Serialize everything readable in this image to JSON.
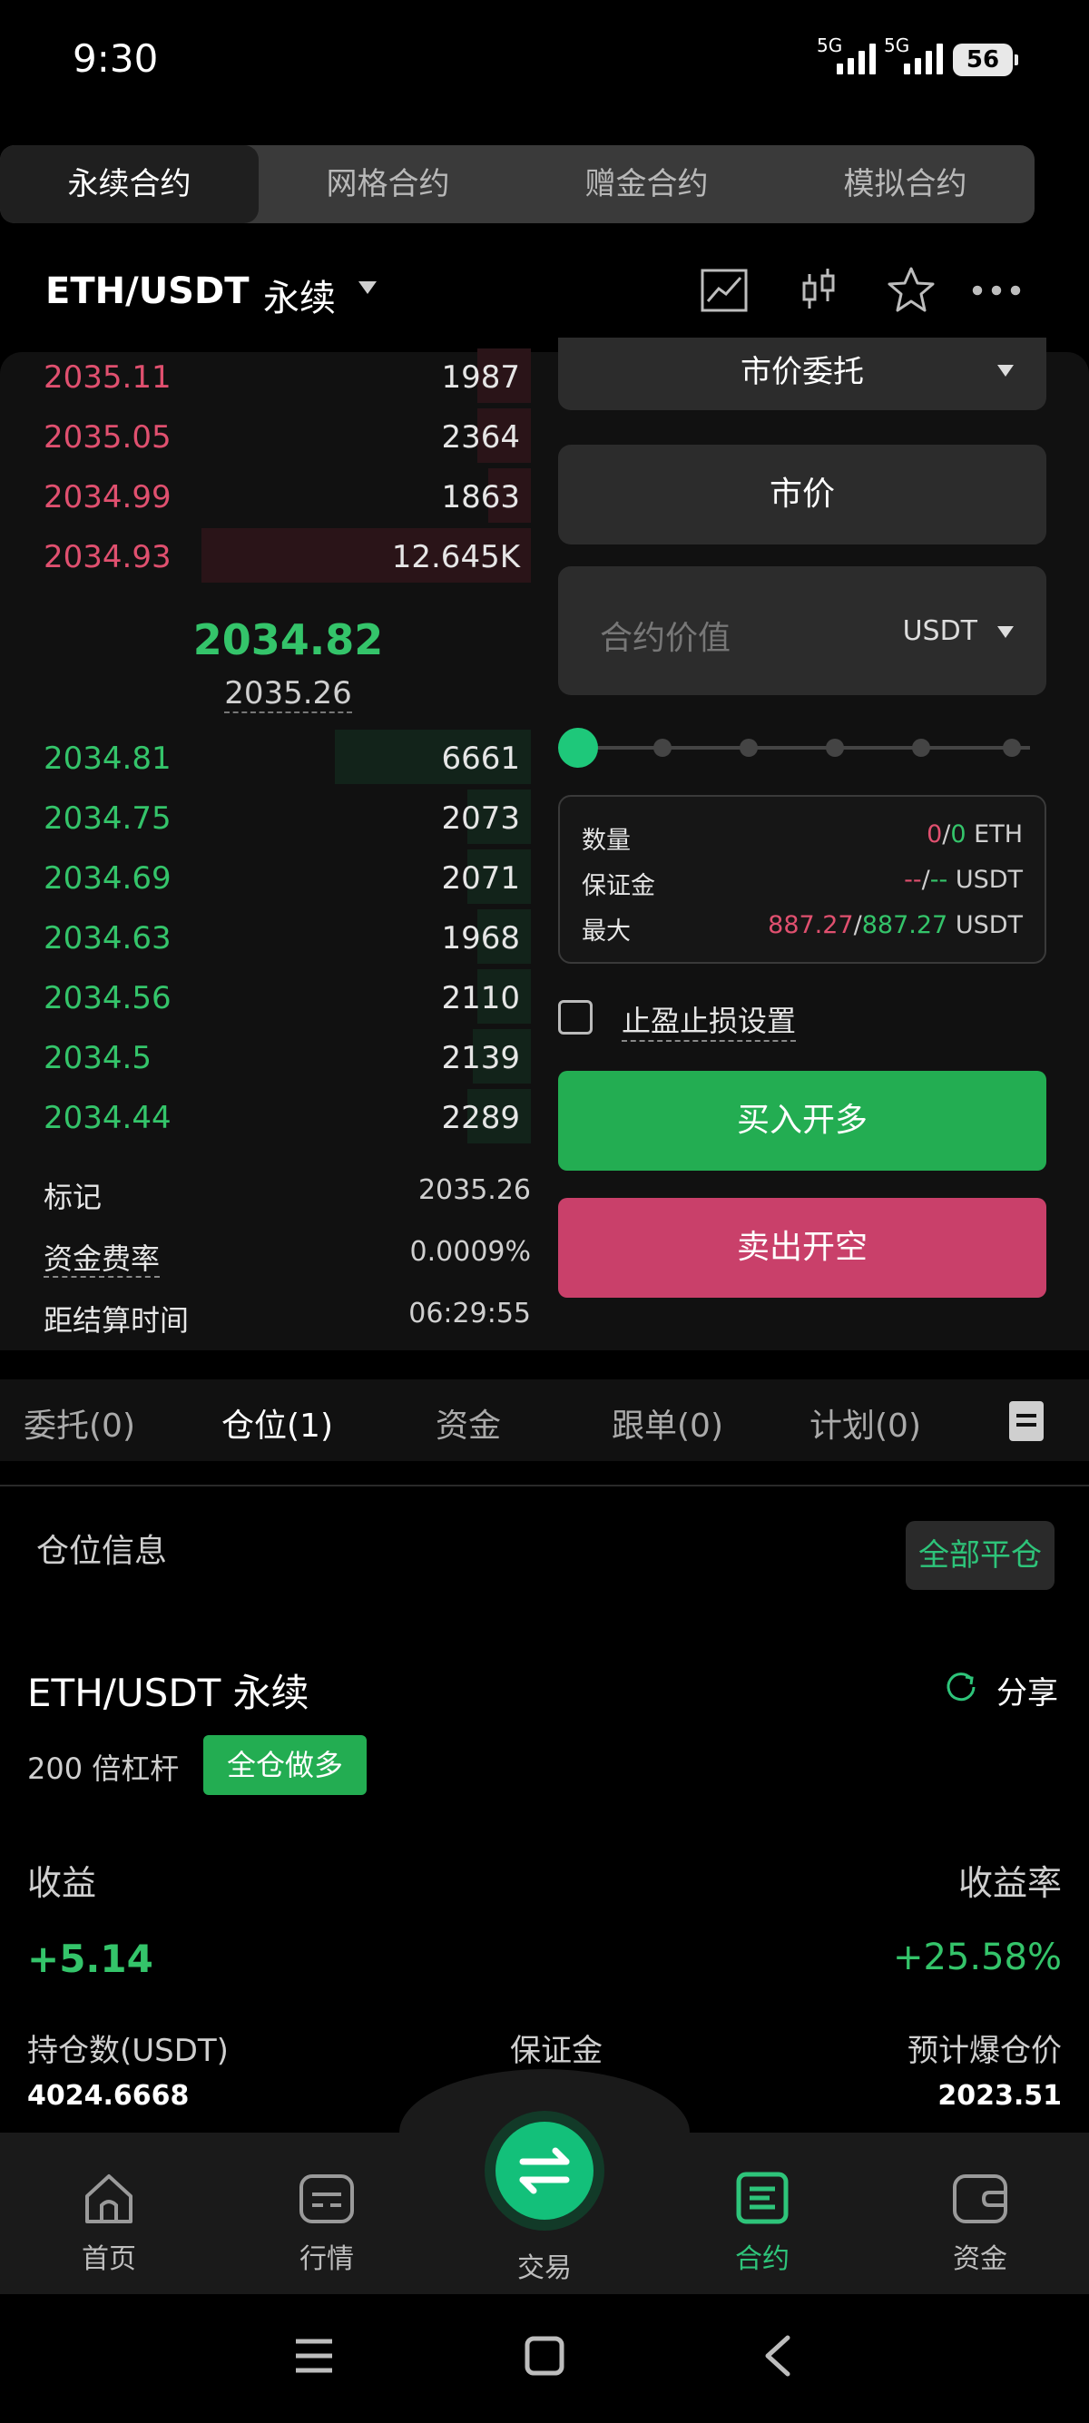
{
  "status": {
    "time": "9:30",
    "sig1": "5G",
    "sig2": "5G",
    "battery": "56"
  },
  "top_tabs": [
    {
      "label": "永续合约"
    },
    {
      "label": "网格合约"
    },
    {
      "label": "赠金合约"
    },
    {
      "label": "模拟合约"
    }
  ],
  "header": {
    "pair": "ETH/USDT",
    "type": "永续",
    "icons": [
      "chart-icon",
      "candlestick-icon",
      "star-icon",
      "more-icon"
    ]
  },
  "orderbook": {
    "asks": [
      {
        "price": "2035.11",
        "qty": "1987",
        "depth": 0.1
      },
      {
        "price": "2035.05",
        "qty": "2364",
        "depth": 0.1
      },
      {
        "price": "2034.99",
        "qty": "1863",
        "depth": 0.08
      },
      {
        "price": "2034.93",
        "qty": "12.645K",
        "depth": 0.62
      }
    ],
    "last_price": "2034.82",
    "mark_price": "2035.26",
    "bids": [
      {
        "price": "2034.81",
        "qty": "6661",
        "depth": 0.37
      },
      {
        "price": "2034.75",
        "qty": "2073",
        "depth": 0.12
      },
      {
        "price": "2034.69",
        "qty": "2071",
        "depth": 0.12
      },
      {
        "price": "2034.63",
        "qty": "1968",
        "depth": 0.1
      },
      {
        "price": "2034.56",
        "qty": "2110",
        "depth": 0.1
      },
      {
        "price": "2034.5",
        "qty": "2139",
        "depth": 0.11
      },
      {
        "price": "2034.44",
        "qty": "2289",
        "depth": 0.12
      }
    ]
  },
  "info": {
    "mark_label": "标记",
    "mark_value": "2035.26",
    "funding_label": "资金费率",
    "funding_value": "0.0009%",
    "settle_label": "距结算时间",
    "settle_value": "06:29:55"
  },
  "order_form": {
    "order_type": "市价委托",
    "market": "市价",
    "value_placeholder": "合约价值",
    "value_unit": "USDT",
    "slider_value": 0,
    "qty_label": "数量",
    "qty_a": "0",
    "qty_sep": "/",
    "qty_b": "0",
    "qty_unit": "ETH",
    "margin_label": "保证金",
    "margin_a": "--",
    "margin_sep": "/",
    "margin_b": "--",
    "margin_unit": "USDT",
    "max_label": "最大",
    "max_a": "887.27",
    "max_sep": "/",
    "max_b": "887.27",
    "max_unit": "USDT",
    "tpsl_label": "止盈止损设置",
    "buy_label": "买入开多",
    "sell_label": "卖出开空"
  },
  "pos_tabs": [
    {
      "label": "委托(0)"
    },
    {
      "label": "仓位(1)"
    },
    {
      "label": "资金"
    },
    {
      "label": "跟单(0)"
    },
    {
      "label": "计划(0)"
    }
  ],
  "position": {
    "info_title": "仓位信息",
    "close_all": "全部平仓",
    "pair": "ETH/USDT 永续",
    "share": "分享",
    "leverage": "200 倍杠杆",
    "side": "全仓做多",
    "pnl_label": "收益",
    "pnl_value": "+5.14",
    "roe_label": "收益率",
    "roe_value": "+25.58%",
    "hold_label": "持仓数(USDT)",
    "hold_value": "4024.6668",
    "margin_label": "保证金",
    "liq_label": "预计爆仓价",
    "liq_value": "2023.51"
  },
  "bottom_nav": [
    {
      "label": "首页",
      "icon": "home-icon"
    },
    {
      "label": "行情",
      "icon": "market-icon"
    },
    {
      "label": "交易",
      "icon": "swap-icon"
    },
    {
      "label": "合约",
      "icon": "contract-icon"
    },
    {
      "label": "资金",
      "icon": "wallet-icon"
    }
  ],
  "colors": {
    "green": "#34c46a",
    "red": "#e0506f",
    "buy": "#23ad52",
    "sell": "#c9406a",
    "accent": "#13c07a"
  }
}
